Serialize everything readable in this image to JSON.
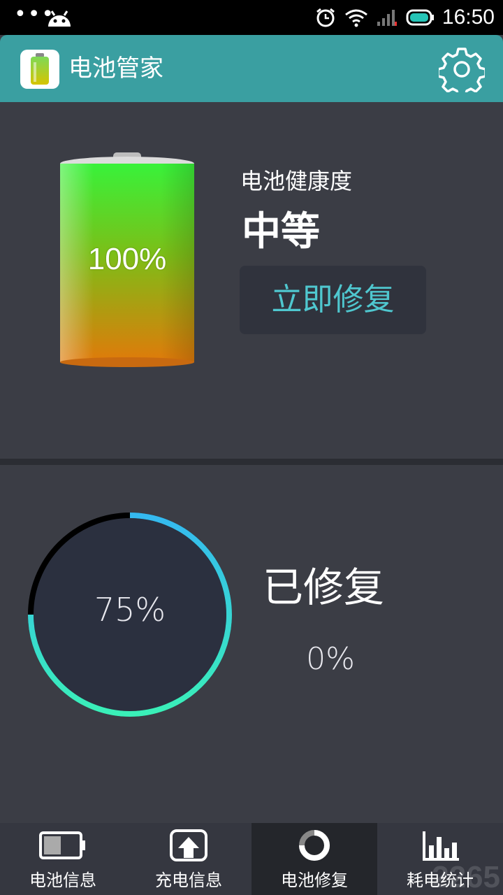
{
  "status_bar": {
    "time": "16:50"
  },
  "header": {
    "title": "电池管家"
  },
  "battery_card": {
    "level": "100%",
    "health_label": "电池健康度",
    "health_value": "中等",
    "repair_button": "立即修复"
  },
  "repair_card": {
    "ring_percent": "75%",
    "ring_fraction": 0.75,
    "repaired_label": "已修复",
    "repaired_percent": "0%"
  },
  "bottom_nav": {
    "items": [
      {
        "label": "电池信息",
        "icon": "battery-icon",
        "active": false
      },
      {
        "label": "充电信息",
        "icon": "upload-icon",
        "active": false
      },
      {
        "label": "电池修复",
        "icon": "ring-icon",
        "active": true
      },
      {
        "label": "耗电统计",
        "icon": "bar-chart-icon",
        "active": false
      }
    ]
  },
  "watermark": "2265",
  "colors": {
    "header": "#3a9fa1",
    "accent": "#4fc7cf",
    "background": "#3b3d45"
  }
}
